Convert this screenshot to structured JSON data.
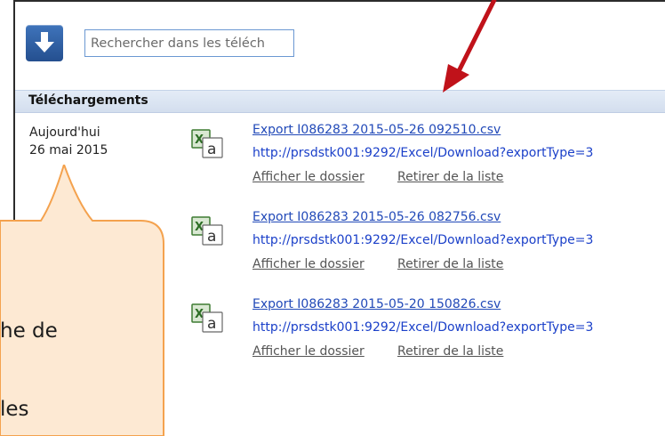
{
  "search": {
    "placeholder": "Rechercher dans les téléch"
  },
  "section": {
    "title": "Téléchargements"
  },
  "date_group": {
    "label": "Aujourd'hui",
    "date": "26 mai 2015"
  },
  "downloads": [
    {
      "filename": "Export I086283 2015-05-26 092510.csv",
      "url": "http://prsdstk001:9292/Excel/Download?exportType=3",
      "show_folder": "Afficher le dossier",
      "remove": "Retirer de la liste"
    },
    {
      "filename": "Export I086283 2015-05-26 082756.csv",
      "url": "http://prsdstk001:9292/Excel/Download?exportType=3",
      "show_folder": "Afficher le dossier",
      "remove": "Retirer de la liste"
    },
    {
      "filename": "Export I086283 2015-05-20 150826.csv",
      "url": "http://prsdstk001:9292/Excel/Download?exportType=3",
      "show_folder": "Afficher le dossier",
      "remove": "Retirer de la liste"
    }
  ],
  "callout": {
    "line1": "he de",
    "line2": "les"
  },
  "icons": {
    "download": "download-arrow-icon",
    "file": "excel-csv-file-icon"
  },
  "colors": {
    "link": "#2149b8",
    "callout_fill": "#fde9d3",
    "callout_border": "#f4a24e",
    "arrow": "#c0121a"
  }
}
